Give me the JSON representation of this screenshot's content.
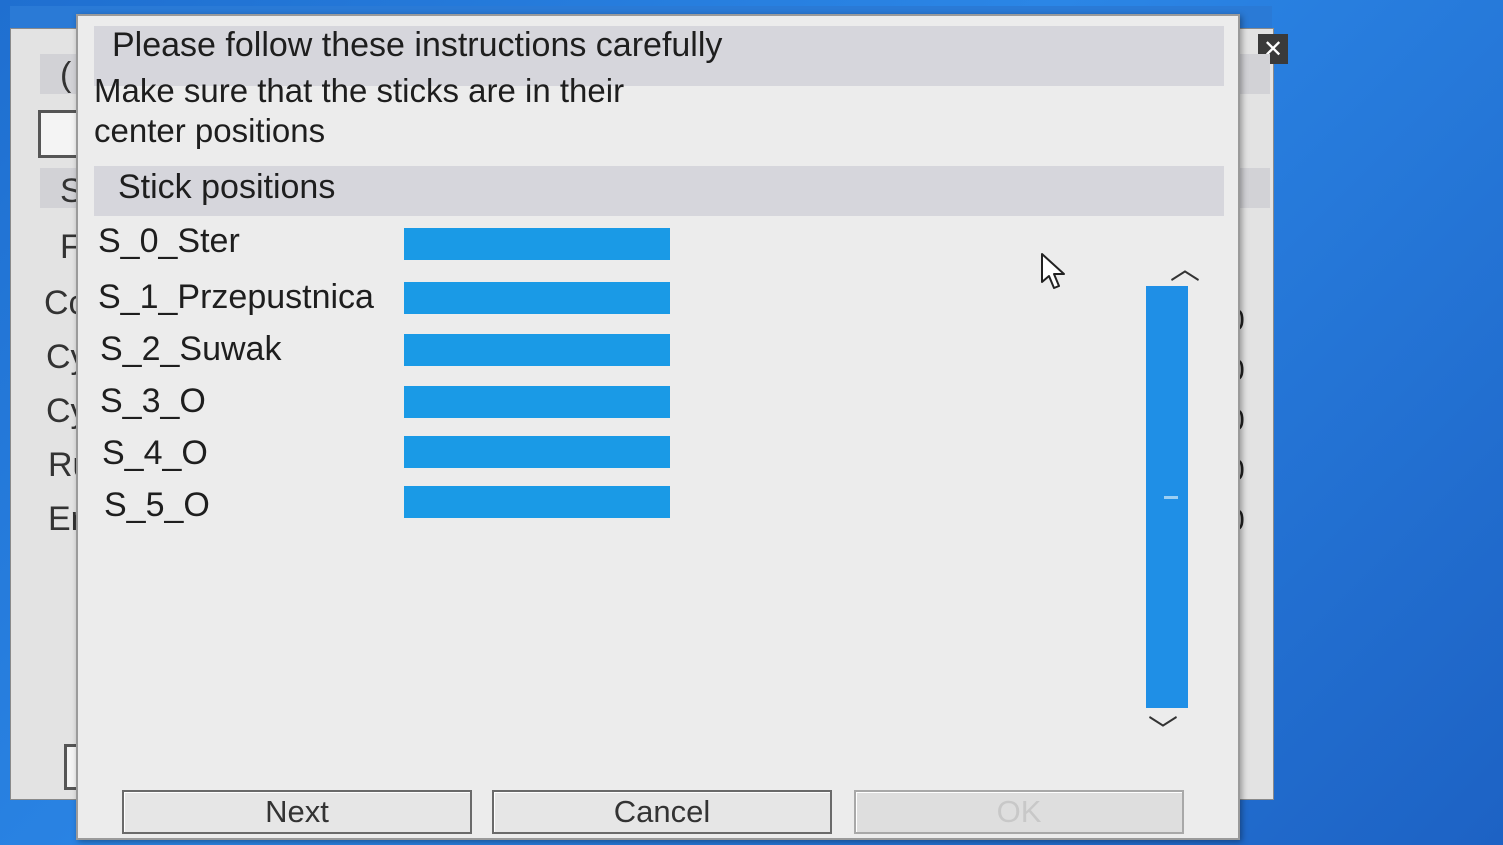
{
  "background": {
    "labels": [
      "(",
      "S",
      "F",
      "Cc",
      "Cy",
      "Cy",
      "Ru",
      "En"
    ],
    "values": [
      "0",
      "0",
      "0",
      "0",
      "0"
    ]
  },
  "dialog": {
    "header": "Please follow these instructions carefully",
    "instruction_line1": "Make sure that the sticks are in their",
    "instruction_line2": "center positions",
    "section_title": "Stick positions",
    "sticks": [
      {
        "label": "S_0_Ster",
        "level": 1.0
      },
      {
        "label": "S_1_Przepustnica",
        "level": 1.0
      },
      {
        "label": "S_2_Suwak",
        "level": 1.0
      },
      {
        "label": "S_3_O",
        "level": 1.0
      },
      {
        "label": "S_4_O",
        "level": 1.0
      },
      {
        "label": "S_5_O",
        "level": 1.0
      }
    ],
    "scroll_level": 1.0,
    "buttons": {
      "next": "Next",
      "cancel": "Cancel",
      "ok": "OK"
    }
  },
  "icons": {
    "close": "close-icon",
    "cursor": "mouse-pointer-icon"
  },
  "colors": {
    "accent": "#1a9ae6",
    "desktop": "#2b86e6"
  }
}
